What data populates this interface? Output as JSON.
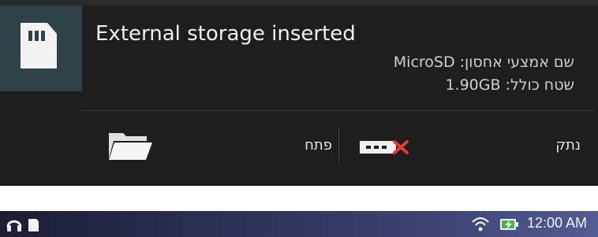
{
  "notification": {
    "title": "External storage inserted",
    "storage_name_line": "שם אמצעי אחסון: MicroSD",
    "total_space_line": "שטח כולל: 1.90GB",
    "actions": {
      "open_label": "פתח",
      "eject_label": "נתק"
    },
    "icons": {
      "main": "sd-card-icon",
      "open": "folder-icon",
      "eject": "eject-usb-icon"
    }
  },
  "status_bar": {
    "time": "12:00 AM",
    "icons": [
      "headphones-icon",
      "sd-card-icon",
      "wifi-icon",
      "battery-charging-icon"
    ]
  },
  "colors": {
    "notification_bg": "#1e1e1e",
    "icon_box_bg": "#2f4247",
    "eject_x": "#e53935",
    "battery_green": "#4caf50"
  }
}
